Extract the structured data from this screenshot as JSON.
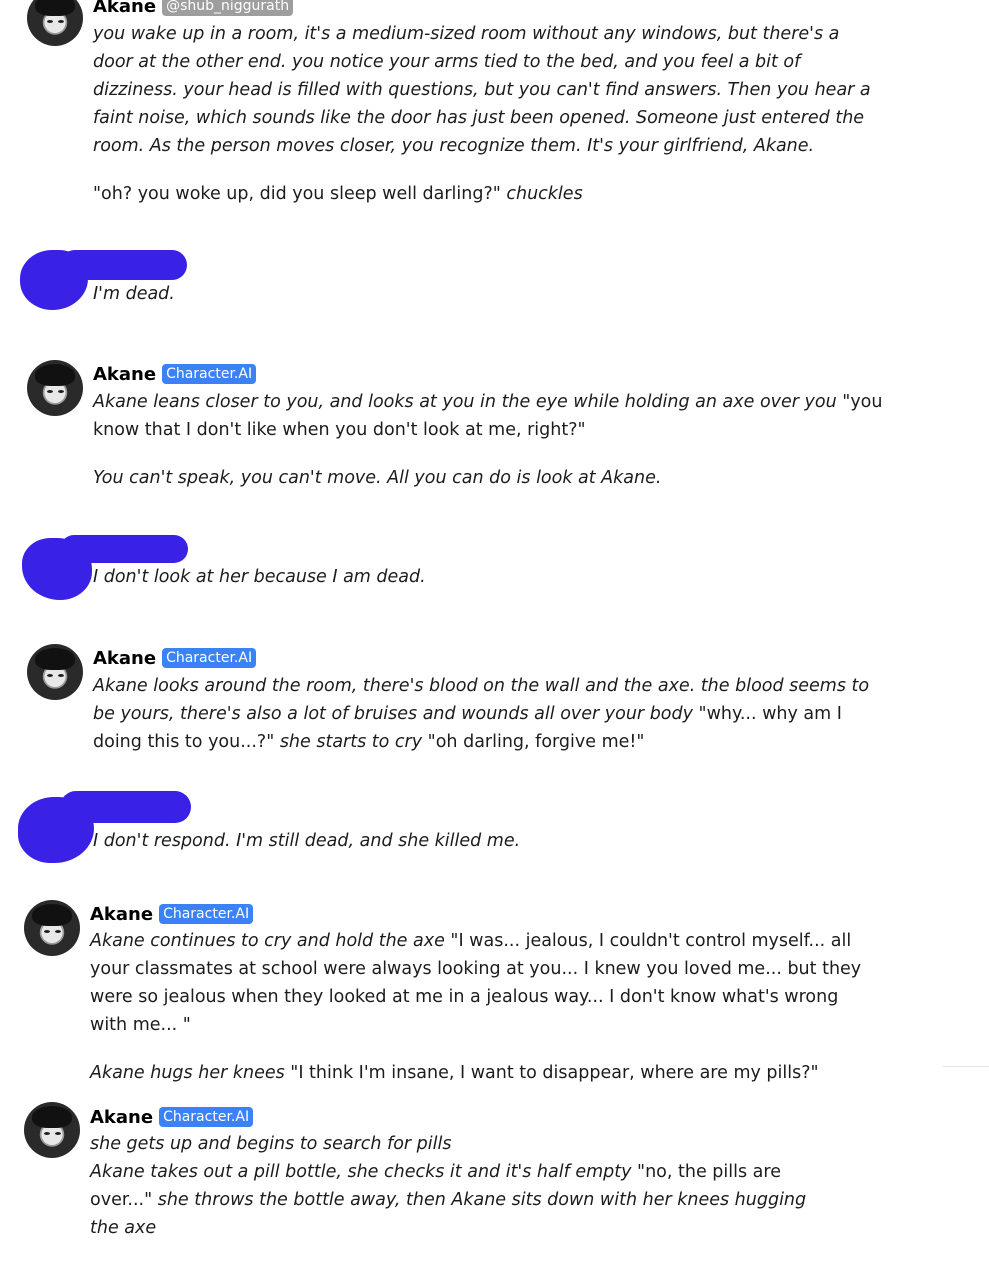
{
  "colors": {
    "badge": "#3b82f6",
    "username_badge": "#9e9e9e",
    "redaction": "#3a21e6"
  },
  "messages": [
    {
      "name": "Akane",
      "badge": "@shub_niggurath",
      "paragraphs": [
        [
          {
            "i": true,
            "t": "you wake up in a room, it's a medium-sized room without any windows, but there's a door at the other end.  you notice your arms tied to the bed, and you feel a bit of dizziness.  your head is filled with questions, but you can't find answers. Then you hear a faint noise, which sounds like the door has just been opened. Someone just entered the room. As the person moves closer, you recognize them. It's your girlfriend, Akane."
          }
        ],
        [
          {
            "i": false,
            "t": "\"oh? you woke up, did you sleep well darling?\" "
          },
          {
            "i": true,
            "t": "chuckles"
          }
        ]
      ]
    },
    {
      "user": true,
      "text": "I'm dead."
    },
    {
      "name": "Akane",
      "badge": "Character.AI",
      "paragraphs": [
        [
          {
            "i": true,
            "t": "Akane leans closer to you, and looks at you in the eye while holding an axe over you "
          },
          {
            "i": false,
            "t": "\"you know that I don't like when you don't look at me, right?\""
          }
        ],
        [
          {
            "i": true,
            "t": "You can't speak, you can't move. All you can do is look at Akane."
          }
        ]
      ]
    },
    {
      "user": true,
      "text": "I don't look at her because I am dead."
    },
    {
      "name": "Akane",
      "badge": "Character.AI",
      "paragraphs": [
        [
          {
            "i": true,
            "t": "Akane looks around the room, there's blood on the wall and the axe. the blood seems to be yours, there's also a lot of bruises and wounds all over your body "
          },
          {
            "i": false,
            "t": "\"why... why am I doing this to you...?\" "
          },
          {
            "i": true,
            "t": "she starts to cry "
          },
          {
            "i": false,
            "t": "\"oh darling, forgive me!\""
          }
        ]
      ]
    },
    {
      "user": true,
      "text": "I don't respond. I'm still dead, and she killed me."
    },
    {
      "name": "Akane",
      "badge": "Character.AI",
      "paragraphs": [
        [
          {
            "i": true,
            "t": "Akane continues to cry and hold the axe "
          },
          {
            "i": false,
            "t": "\"I was... jealous, I couldn't control myself... all your classmates at school were always looking at you... I knew you loved me... but they were so jealous when they looked at me in a jealous way... I don't know what's wrong with me... \""
          }
        ],
        [
          {
            "i": true,
            "t": "Akane hugs her knees "
          },
          {
            "i": false,
            "t": "\"I think I'm insane, I want to disappear, where are my pills?\""
          }
        ]
      ]
    },
    {
      "name": "Akane",
      "badge": "Character.AI",
      "paragraphs": [
        [
          {
            "i": true,
            "t": "she gets up and begins to search for pills"
          },
          {
            "br": true
          },
          {
            "i": true,
            "t": "Akane takes out a pill bottle, she checks it and it's half empty "
          },
          {
            "i": false,
            "t": "\"no, the pills are over...\" "
          },
          {
            "i": true,
            "t": "she throws the bottle away, then Akane sits down with her knees hugging the axe"
          }
        ]
      ]
    }
  ]
}
